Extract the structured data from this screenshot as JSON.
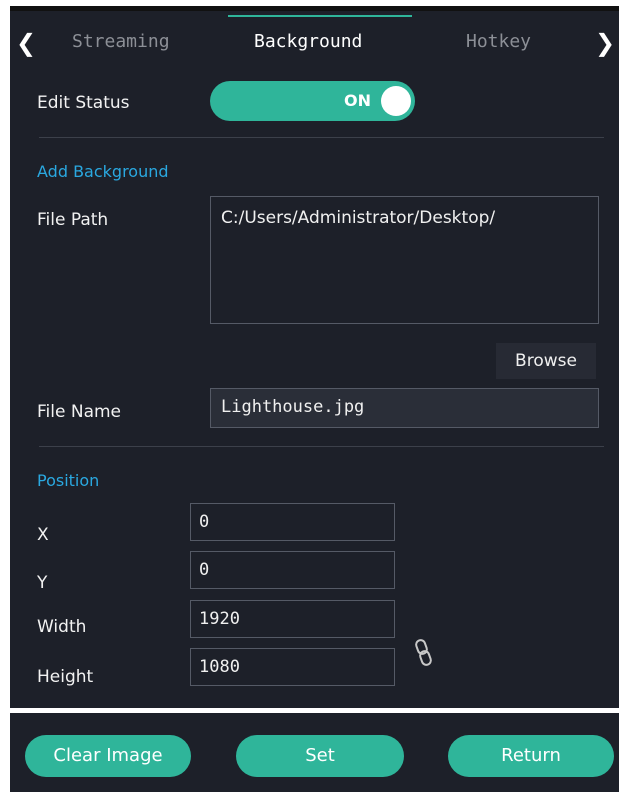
{
  "tabs": {
    "prev_arrow": "❮",
    "next_arrow": "❯",
    "items": [
      {
        "label": "Streaming"
      },
      {
        "label": "Background"
      },
      {
        "label": "Hotkey"
      }
    ],
    "active": "Background"
  },
  "edit_status": {
    "label": "Edit Status",
    "toggle_text": "ON"
  },
  "add_background": {
    "heading": "Add Background",
    "file_path_label": "File Path",
    "file_path_value": "C:/Users/Administrator/Desktop/",
    "browse_label": "Browse",
    "file_name_label": "File Name",
    "file_name_value": "Lighthouse.jpg"
  },
  "position": {
    "heading": "Position",
    "x_label": "X",
    "x_value": "0",
    "y_label": "Y",
    "y_value": "0",
    "width_label": "Width",
    "width_value": "1920",
    "height_label": "Height",
    "height_value": "1080",
    "link_icon": "chain-link-icon"
  },
  "footer": {
    "clear_label": "Clear Image",
    "set_label": "Set",
    "return_label": "Return"
  },
  "colors": {
    "background": "#1d2029",
    "accent": "#2fb59a",
    "section_heading": "#2aa8e0"
  }
}
